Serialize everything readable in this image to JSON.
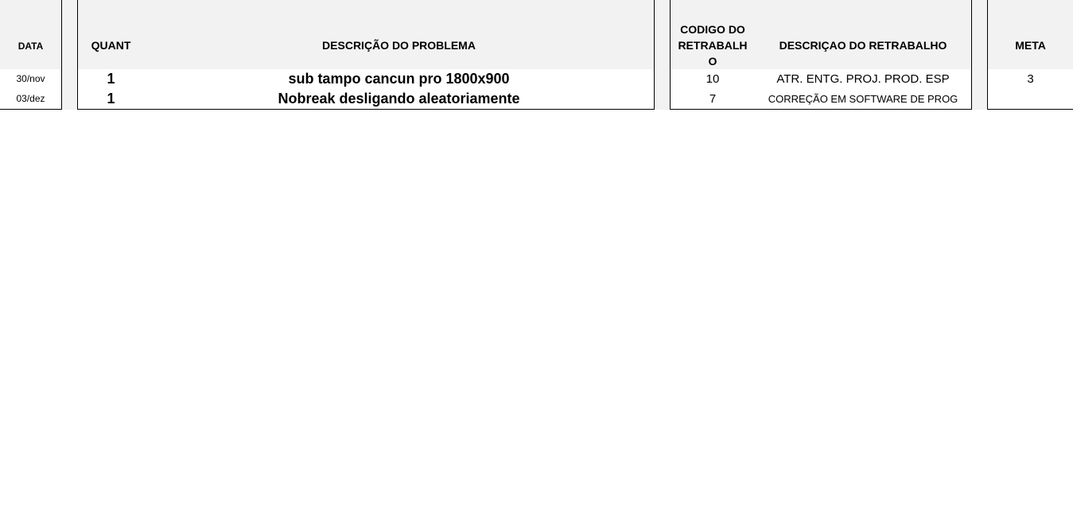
{
  "headers": {
    "data": "DATA",
    "quant": "QUANT",
    "descricao_problema": "DESCRIÇÃO DO PROBLEMA",
    "codigo_retrabalho": "CODIGO DO RETRABALH O",
    "descricao_retrabalho": "DESCRIÇAO DO RETRABALHO",
    "meta": "META"
  },
  "rows": [
    {
      "data": "30/nov",
      "quant": "1",
      "descricao_problema": "sub tampo cancun pro 1800x900",
      "codigo_retrabalho": "10",
      "descricao_retrabalho": "ATR. ENTG. PROJ. PROD. ESP",
      "meta": "3"
    },
    {
      "data": "03/dez",
      "quant": "1",
      "descricao_problema": "Nobreak desligando aleatoriamente",
      "codigo_retrabalho": "7",
      "descricao_retrabalho": "CORREÇÃO EM SOFTWARE DE PROG",
      "meta": ""
    }
  ]
}
